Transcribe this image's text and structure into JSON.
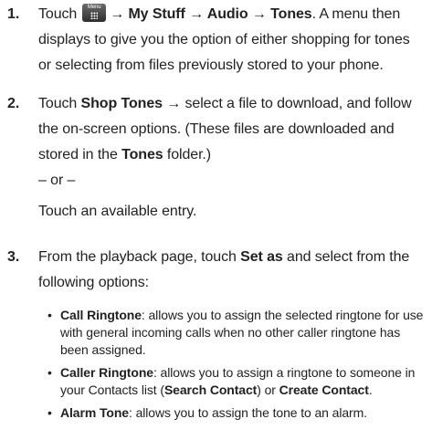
{
  "steps": [
    {
      "number": "1.",
      "menu_key_label": "Menu",
      "p1_after_icon": "→ ",
      "p1_bold": "My Stuff → Audio → Tones",
      "p1_text": ". A menu then displays to give you the option of either shopping for tones or selecting from files previously stored to your phone.",
      "p1_before": "Touch"
    },
    {
      "number": "2.",
      "p1_before": "Touch ",
      "p1_bold": "Shop Tones →",
      "p1_mid": " select a file to download, and follow the on-screen options. (These files are downloaded and stored in the ",
      "p1_bold2": "Tones",
      "p1_end": " folder.)",
      "or": "– or –",
      "p2": "Touch an available entry."
    },
    {
      "number": "3.",
      "p1_before": "From the playback page, touch ",
      "p1_bold": "Set as",
      "p1_end": " and select from the following options:"
    }
  ],
  "bullets": [
    {
      "bold": "Call Ringtone",
      "text": ": allows you to assign the selected ringtone for use with general incoming calls when no other caller ringtone has been assigned."
    },
    {
      "bold": "Caller Ringtone",
      "text": ": allows you to assign a ringtone to someone in your Contacts list (",
      "bold2": "Search Contact",
      "text2": ") or ",
      "bold3": "Create Contact",
      "text3": "."
    },
    {
      "bold": "Alarm Tone",
      "text": ": allows you to assign the tone to an alarm."
    }
  ],
  "icons": {
    "menu_key": "menu-key-icon",
    "bullet": "bullet-dot"
  }
}
